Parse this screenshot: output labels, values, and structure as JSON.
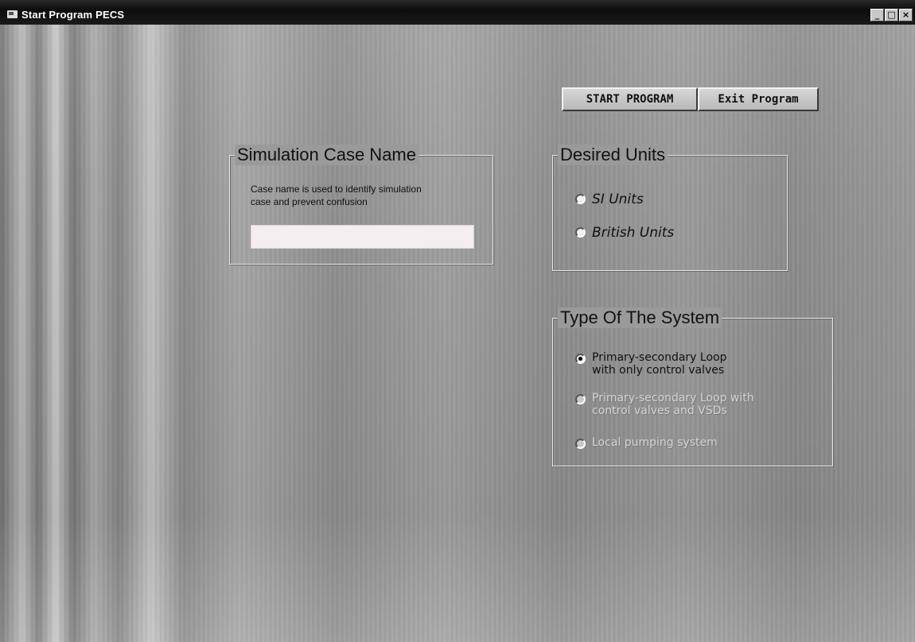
{
  "window": {
    "title": "Start Program PECS",
    "controls": {
      "minimize": "_",
      "maximize": "□",
      "close": "×"
    }
  },
  "buttons": {
    "start_label": "START PROGRAM",
    "exit_label": "Exit Program"
  },
  "case_name_group": {
    "title": "Simulation Case Name",
    "hint_line1": "Case name is used to identify simulation",
    "hint_line2": "case and prevent confusion",
    "input_value": ""
  },
  "units_group": {
    "title": "Desired Units",
    "options": [
      {
        "label": "SI Units",
        "selected": false,
        "enabled": true
      },
      {
        "label": "British Units",
        "selected": false,
        "enabled": true
      }
    ]
  },
  "system_group": {
    "title": "Type Of The System",
    "options": [
      {
        "line1": "Primary-secondary Loop",
        "line2": "with only control valves",
        "selected": true,
        "enabled": true
      },
      {
        "line1": "Primary-secondary Loop with",
        "line2": "control valves and VSDs",
        "selected": false,
        "enabled": false
      },
      {
        "line1": "Local pumping system",
        "line2": "",
        "selected": false,
        "enabled": false
      }
    ]
  },
  "icons": [
    "app-icon",
    "minimize-icon",
    "maximize-icon",
    "close-icon"
  ]
}
